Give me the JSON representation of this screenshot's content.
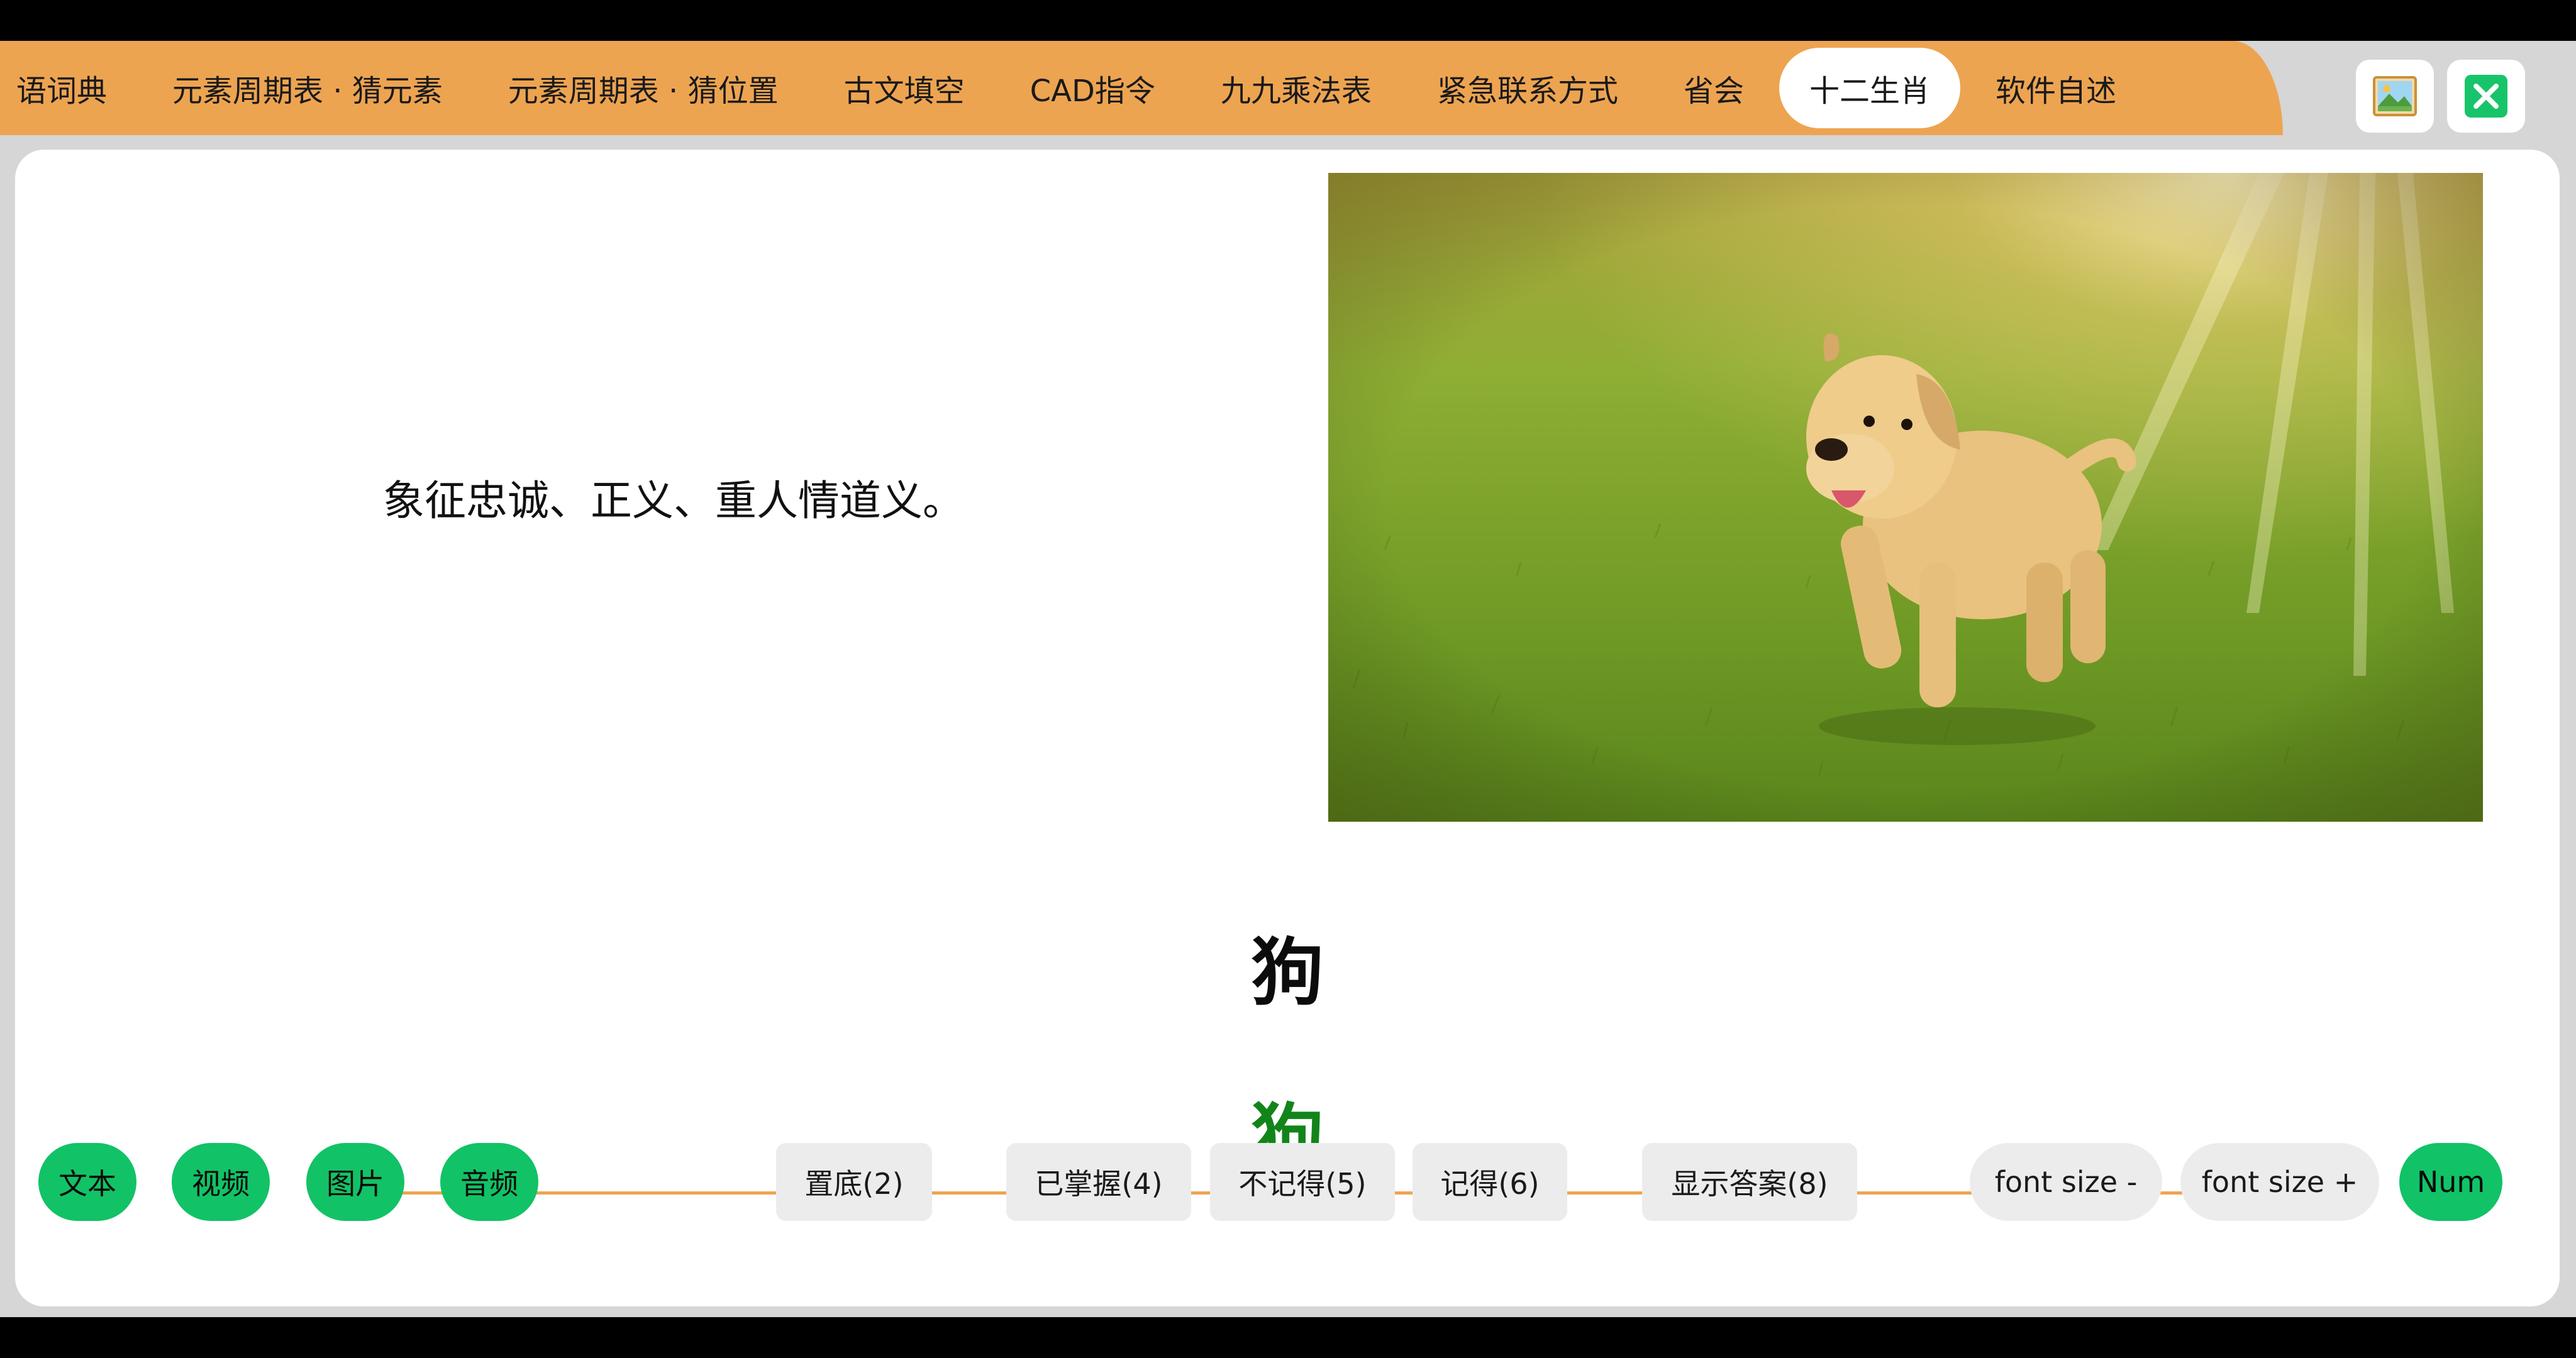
{
  "tabs": [
    {
      "label": "语词典"
    },
    {
      "label": "元素周期表 · 猜元素"
    },
    {
      "label": "元素周期表 · 猜位置"
    },
    {
      "label": "古文填空"
    },
    {
      "label": "CAD指令"
    },
    {
      "label": "九九乘法表"
    },
    {
      "label": "紧急联系方式"
    },
    {
      "label": "省会"
    },
    {
      "label": "十二生肖",
      "active": true
    },
    {
      "label": "软件自述"
    }
  ],
  "window_buttons": {
    "picture_icon": "picture-icon",
    "close_icon": "close-icon"
  },
  "card": {
    "description": "象征忠诚、正义、重人情道义。",
    "question": "狗",
    "answer": "狗",
    "image_subject": "puppy running on grass"
  },
  "media_buttons": {
    "text": "文本",
    "video": "视频",
    "image": "图片",
    "audio": "音频"
  },
  "actions": {
    "bottom": "置底(2)",
    "mastered": "已掌握(4)",
    "forgot": "不记得(5)",
    "remember": "记得(6)",
    "show_answer": "显示答案(8)"
  },
  "font_controls": {
    "decrease": "font size -",
    "increase": "font size +",
    "num": "Num"
  },
  "colors": {
    "accent": "#eda451",
    "green": "#12c266",
    "answer_green": "#12851a"
  }
}
